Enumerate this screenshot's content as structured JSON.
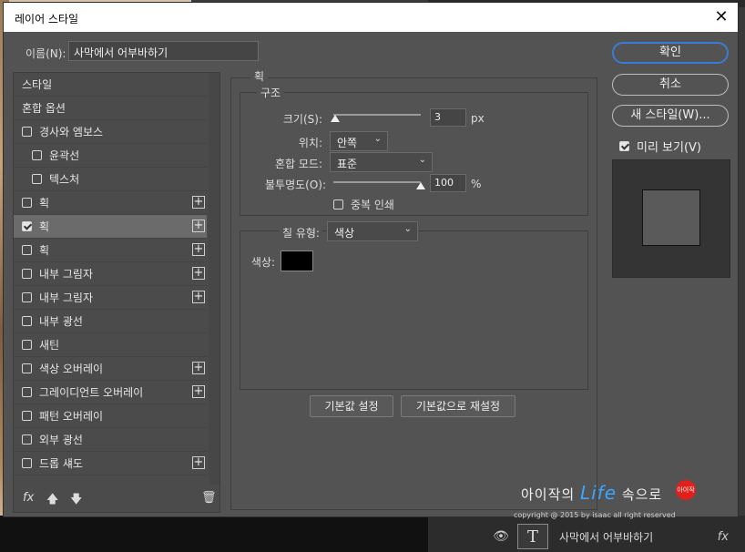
{
  "dialog": {
    "title": "레이어 스타일",
    "close_symbol": "✕",
    "name_label": "이름(N):",
    "name_value": "사막에서 어부바하기"
  },
  "styles_list": {
    "items": [
      {
        "label": "스타일",
        "checkbox": false,
        "checked": false,
        "plus": false,
        "indent": false,
        "selected": false
      },
      {
        "label": "혼합 옵션",
        "checkbox": false,
        "checked": false,
        "plus": false,
        "indent": false,
        "selected": false
      },
      {
        "label": "경사와 엠보스",
        "checkbox": true,
        "checked": false,
        "plus": false,
        "indent": false,
        "selected": false
      },
      {
        "label": "윤곽선",
        "checkbox": true,
        "checked": false,
        "plus": false,
        "indent": true,
        "selected": false
      },
      {
        "label": "텍스처",
        "checkbox": true,
        "checked": false,
        "plus": false,
        "indent": true,
        "selected": false
      },
      {
        "label": "획",
        "checkbox": true,
        "checked": false,
        "plus": true,
        "indent": false,
        "selected": false
      },
      {
        "label": "획",
        "checkbox": true,
        "checked": true,
        "plus": true,
        "indent": false,
        "selected": true
      },
      {
        "label": "획",
        "checkbox": true,
        "checked": false,
        "plus": true,
        "indent": false,
        "selected": false
      },
      {
        "label": "내부 그림자",
        "checkbox": true,
        "checked": false,
        "plus": true,
        "indent": false,
        "selected": false
      },
      {
        "label": "내부 그림자",
        "checkbox": true,
        "checked": false,
        "plus": true,
        "indent": false,
        "selected": false
      },
      {
        "label": "내부 광선",
        "checkbox": true,
        "checked": false,
        "plus": false,
        "indent": false,
        "selected": false
      },
      {
        "label": "새틴",
        "checkbox": true,
        "checked": false,
        "plus": false,
        "indent": false,
        "selected": false
      },
      {
        "label": "색상 오버레이",
        "checkbox": true,
        "checked": false,
        "plus": true,
        "indent": false,
        "selected": false
      },
      {
        "label": "그레이디언트 오버레이",
        "checkbox": true,
        "checked": false,
        "plus": true,
        "indent": false,
        "selected": false
      },
      {
        "label": "패턴 오버레이",
        "checkbox": true,
        "checked": false,
        "plus": false,
        "indent": false,
        "selected": false
      },
      {
        "label": "외부 광선",
        "checkbox": true,
        "checked": false,
        "plus": false,
        "indent": false,
        "selected": false
      },
      {
        "label": "드롭 섀도",
        "checkbox": true,
        "checked": false,
        "plus": true,
        "indent": false,
        "selected": false
      }
    ],
    "bottom_icons": {
      "fx": "fx",
      "up": "🡅",
      "down": "🡇",
      "trash": "🗑"
    }
  },
  "stroke": {
    "section_title": "획",
    "structure_title": "구조",
    "size_label": "크기(S):",
    "size_value": "3",
    "size_unit": "px",
    "size_fraction": 0.02,
    "position_label": "위치:",
    "position_value": "안쪽",
    "blend_label": "혼합 모드:",
    "blend_value": "표준",
    "opacity_label": "불투명도(O):",
    "opacity_value": "100",
    "opacity_unit": "%",
    "opacity_fraction": 1.0,
    "overprint_label": "중복 인쇄",
    "fill_type_label": "칠 유형:",
    "fill_type_value": "색상",
    "color_label": "색상:",
    "color_hex": "#000000",
    "make_default": "기본값 설정",
    "reset_default": "기본값으로 재설정"
  },
  "right": {
    "ok": "확인",
    "cancel": "취소",
    "new_style": "새 스타일(W)...",
    "preview_label": "미리 보기(V)",
    "preview_checked": true
  },
  "layer": {
    "thumb": "T",
    "name": "사막에서 어부바하기",
    "fx": "fx",
    "eye": "👁"
  },
  "watermark": {
    "pre": "아이작의 ",
    "life": "Life",
    "post": " 속으로",
    "badge": "아이작",
    "copyright": "copyright @ 2015 by isaac all right reserved"
  },
  "colors": {
    "accent": "#3a7bd5",
    "dialog_bg": "#535353"
  }
}
